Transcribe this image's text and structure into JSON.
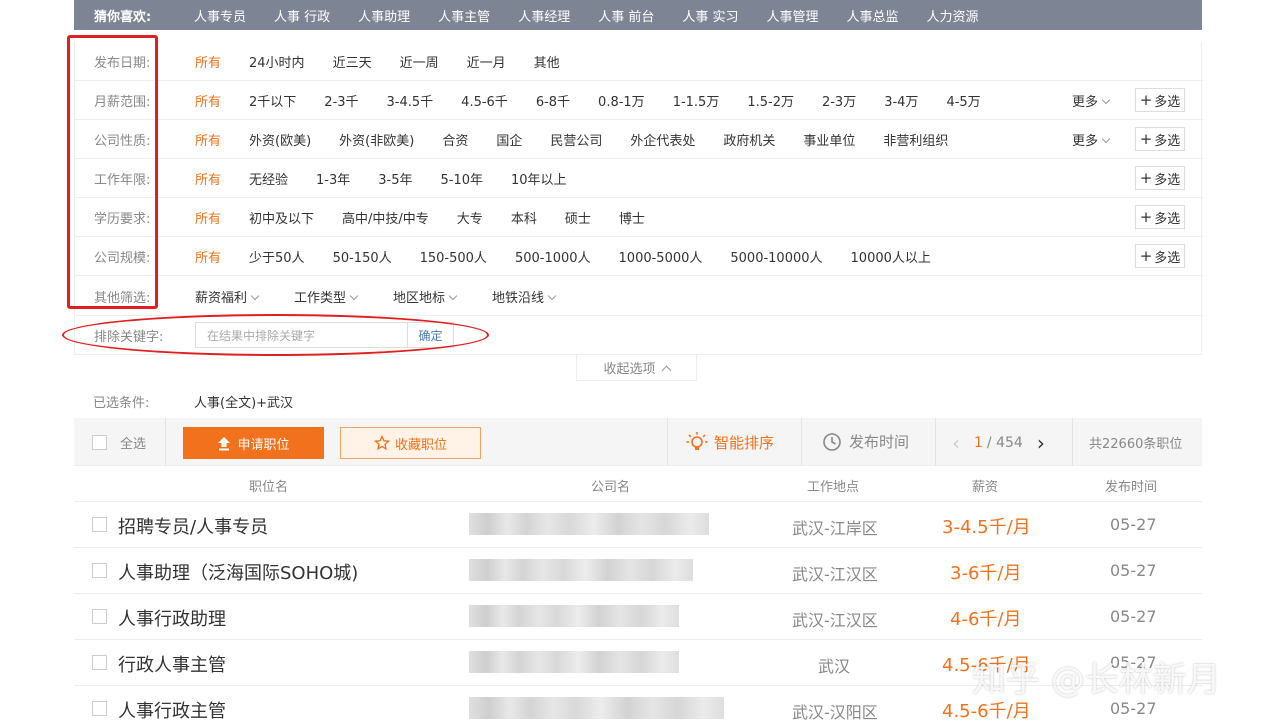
{
  "guess": {
    "title": "猜你喜欢:",
    "items": [
      "人事专员",
      "人事 行政",
      "人事助理",
      "人事主管",
      "人事经理",
      "人事 前台",
      "人事 实习",
      "人事管理",
      "人事总监",
      "人力资源"
    ]
  },
  "filters": {
    "date": {
      "label": "发布日期:",
      "options": [
        "所有",
        "24小时内",
        "近三天",
        "近一周",
        "近一月",
        "其他"
      ]
    },
    "salary": {
      "label": "月薪范围:",
      "options": [
        "所有",
        "2千以下",
        "2-3千",
        "3-4.5千",
        "4.5-6千",
        "6-8千",
        "0.8-1万",
        "1-1.5万",
        "1.5-2万",
        "2-3万",
        "3-4万",
        "4-5万"
      ],
      "more": "更多",
      "multi": "多选"
    },
    "company_type": {
      "label": "公司性质:",
      "options": [
        "所有",
        "外资(欧美)",
        "外资(非欧美)",
        "合资",
        "国企",
        "民营公司",
        "外企代表处",
        "政府机关",
        "事业单位",
        "非营利组织"
      ],
      "more": "更多",
      "multi": "多选"
    },
    "experience": {
      "label": "工作年限:",
      "options": [
        "所有",
        "无经验",
        "1-3年",
        "3-5年",
        "5-10年",
        "10年以上"
      ],
      "multi": "多选"
    },
    "education": {
      "label": "学历要求:",
      "options": [
        "所有",
        "初中及以下",
        "高中/中技/中专",
        "大专",
        "本科",
        "硕士",
        "博士"
      ],
      "multi": "多选"
    },
    "company_size": {
      "label": "公司规模:",
      "options": [
        "所有",
        "少于50人",
        "50-150人",
        "150-500人",
        "500-1000人",
        "1000-5000人",
        "5000-10000人",
        "10000人以上"
      ],
      "multi": "多选"
    },
    "other": {
      "label": "其他筛选:",
      "options": [
        "薪资福利",
        "工作类型",
        "地区地标",
        "地铁沿线"
      ]
    },
    "exclude": {
      "label": "排除关键字:",
      "placeholder": "在结果中排除关键字",
      "confirm": "确定"
    },
    "collapse": "收起选项"
  },
  "selected": {
    "label": "已选条件:",
    "value": "人事(全文)+武汉"
  },
  "toolbar": {
    "select_all": "全选",
    "apply": "申请职位",
    "save": "收藏职位",
    "smart_sort": "智能排序",
    "publish_sort": "发布时间",
    "page_current": "1",
    "page_total": "/ 454",
    "total": "共22660条职位"
  },
  "table": {
    "headers": [
      "职位名",
      "公司名",
      "工作地点",
      "薪资",
      "发布时间"
    ],
    "rows": [
      {
        "title": "招聘专员/人事专员",
        "location": "武汉-江岸区",
        "salary": "3-4.5千/月",
        "date": "05-27"
      },
      {
        "title": "人事助理（泛海国际SOHO城)",
        "location": "武汉-江汉区",
        "salary": "3-6千/月",
        "date": "05-27"
      },
      {
        "title": "人事行政助理",
        "location": "武汉-江汉区",
        "salary": "4-6千/月",
        "date": "05-27"
      },
      {
        "title": "行政人事主管",
        "location": "武汉",
        "salary": "4.5-6千/月",
        "date": "05-27"
      },
      {
        "title": "人事行政主管",
        "location": "武汉-汉阳区",
        "salary": "4.5-6千/月",
        "date": "05-27"
      }
    ]
  },
  "watermark": "知乎 @长林新月",
  "colors": {
    "accent": "#f2711c",
    "annotation": "#e02020",
    "topbar": "#7d8494"
  }
}
